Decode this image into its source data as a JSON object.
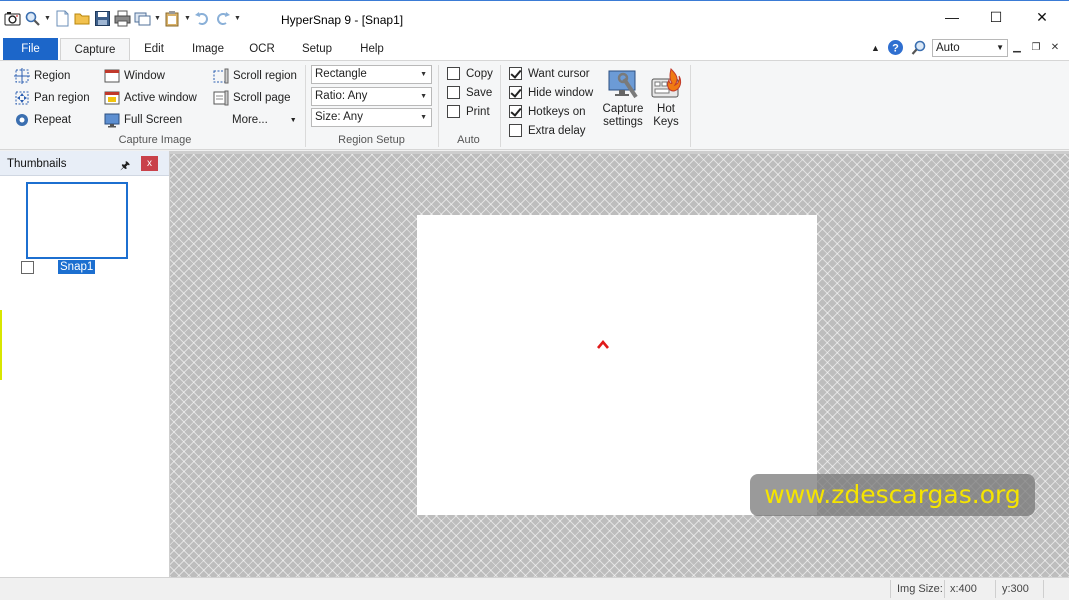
{
  "window": {
    "title": "HyperSnap 9 - [Snap1]",
    "minimize_glyph": "—",
    "maximize_glyph": "☐",
    "close_glyph": "✕"
  },
  "quick_access": {
    "icons": [
      "hypersnap-camera-icon",
      "magnifier-icon",
      "new-document-icon",
      "open-folder-icon",
      "save-icon",
      "print-icon",
      "copy-multiple-icon",
      "clipboard-icon",
      "undo-icon",
      "redo-icon"
    ]
  },
  "tabs": [
    {
      "label": "File"
    },
    {
      "label": "Capture"
    },
    {
      "label": "Edit"
    },
    {
      "label": "Image"
    },
    {
      "label": "OCR"
    },
    {
      "label": "Setup"
    },
    {
      "label": "Help"
    }
  ],
  "zoom": {
    "value": "Auto"
  },
  "ribbon": {
    "capture_image": {
      "label": "Capture Image",
      "region": "Region",
      "pan_region": "Pan region",
      "repeat": "Repeat",
      "window": "Window",
      "active_window": "Active window",
      "full_screen": "Full Screen",
      "scroll_region": "Scroll region",
      "scroll_page": "Scroll page",
      "more": "More..."
    },
    "region_setup": {
      "label": "Region Setup",
      "shape": "Rectangle",
      "ratio": "Ratio: Any",
      "size": "Size: Any"
    },
    "auto": {
      "label": "Auto",
      "copy": {
        "label": "Copy",
        "checked": false
      },
      "save": {
        "label": "Save",
        "checked": false
      },
      "print": {
        "label": "Print",
        "checked": false
      }
    },
    "options": {
      "want_cursor": {
        "label": "Want cursor",
        "checked": true
      },
      "hide_window": {
        "label": "Hide window",
        "checked": true
      },
      "hotkeys_on": {
        "label": "Hotkeys on",
        "checked": true
      },
      "extra_delay": {
        "label": "Extra delay",
        "checked": false
      },
      "capture_settings_1": "Capture",
      "capture_settings_2": "settings",
      "hot_keys_1": "Hot",
      "hot_keys_2": "Keys"
    }
  },
  "thumbnails": {
    "title": "Thumbnails",
    "pin_glyph": "🖈",
    "close_glyph": "x",
    "items": [
      {
        "label": "Snap1"
      }
    ]
  },
  "watermark": {
    "text": "www.zdescargas.org"
  },
  "status": {
    "img_size_label": "Img Size:",
    "x": "x:400",
    "y": "y:300"
  },
  "colors": {
    "accent": "#1c66c9",
    "watermark_text": "#f5e400",
    "close_red": "#c9414a"
  }
}
